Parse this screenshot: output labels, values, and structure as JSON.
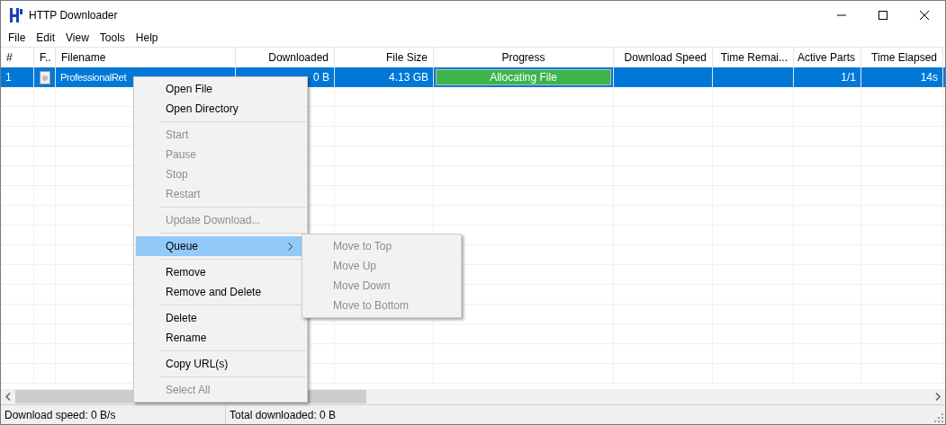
{
  "window": {
    "title": "HTTP Downloader"
  },
  "menu_bar": [
    "File",
    "Edit",
    "View",
    "Tools",
    "Help"
  ],
  "table": {
    "columns": [
      "#",
      "F..",
      "Filename",
      "Downloaded",
      "File Size",
      "Progress",
      "Download Speed",
      "Time Remai...",
      "Active Parts",
      "Time Elapsed"
    ],
    "rows": [
      {
        "selected": true,
        "number": "1",
        "filename": "ProfessionalRet",
        "downloaded": "0 B",
        "file_size": "4.13 GB",
        "progress": {
          "label": "Allocating File",
          "level": 1
        },
        "active_parts": "1/1",
        "time_elapsed": "14s"
      }
    ]
  },
  "context_menu": [
    {
      "kind": "item",
      "label": "Open File",
      "disabled": false,
      "selected": false,
      "submenu": false
    },
    {
      "kind": "item",
      "label": "Open Directory",
      "disabled": false,
      "selected": false,
      "submenu": false
    },
    {
      "kind": "separator"
    },
    {
      "kind": "item",
      "label": "Start",
      "disabled": true,
      "selected": false,
      "submenu": false
    },
    {
      "kind": "item",
      "label": "Pause",
      "disabled": true,
      "selected": false,
      "submenu": false
    },
    {
      "kind": "item",
      "label": "Stop",
      "disabled": true,
      "selected": false,
      "submenu": false
    },
    {
      "kind": "item",
      "label": "Restart",
      "disabled": true,
      "selected": false,
      "submenu": false
    },
    {
      "kind": "separator"
    },
    {
      "kind": "item",
      "label": "Update Download...",
      "disabled": true,
      "selected": false,
      "submenu": false
    },
    {
      "kind": "separator"
    },
    {
      "kind": "item",
      "label": "Queue",
      "disabled": false,
      "selected": true,
      "submenu": true
    },
    {
      "kind": "separator"
    },
    {
      "kind": "item",
      "label": "Remove",
      "disabled": false,
      "selected": false,
      "submenu": false
    },
    {
      "kind": "item",
      "label": "Remove and Delete",
      "disabled": false,
      "selected": false,
      "submenu": false
    },
    {
      "kind": "separator"
    },
    {
      "kind": "item",
      "label": "Delete",
      "disabled": false,
      "selected": false,
      "submenu": false
    },
    {
      "kind": "item",
      "label": "Rename",
      "disabled": false,
      "selected": false,
      "submenu": false
    },
    {
      "kind": "separator"
    },
    {
      "kind": "item",
      "label": "Copy URL(s)",
      "disabled": false,
      "selected": false,
      "submenu": false
    },
    {
      "kind": "separator"
    },
    {
      "kind": "item",
      "label": "Select All",
      "disabled": true,
      "selected": false,
      "submenu": false
    }
  ],
  "submenu": [
    {
      "label": "Move to Top",
      "disabled": true
    },
    {
      "label": "Move Up",
      "disabled": true
    },
    {
      "label": "Move Down",
      "disabled": true
    },
    {
      "label": "Move to Bottom",
      "disabled": true
    }
  ],
  "status_bar": [
    "Download speed: 0 B/s",
    "Total downloaded: 0 B"
  ]
}
